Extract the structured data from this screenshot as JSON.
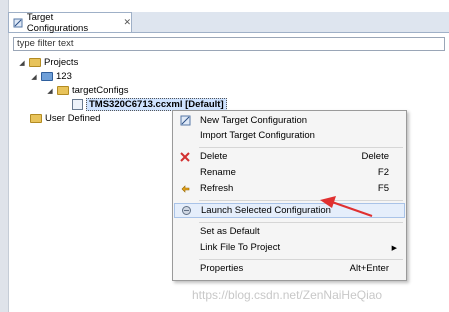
{
  "view": {
    "tab_title": "Target Configurations",
    "filter_placeholder": "type filter text"
  },
  "tree": {
    "projects": "Projects",
    "project_123": "123",
    "target_configs": "targetConfigs",
    "config_file": "TMS320C6713.ccxml [Default]",
    "user_defined": "User Defined"
  },
  "menu": {
    "new_target": "New Target Configuration",
    "import_target": "Import Target Configuration",
    "delete": "Delete",
    "delete_sc": "Delete",
    "rename": "Rename",
    "rename_sc": "F2",
    "refresh": "Refresh",
    "refresh_sc": "F5",
    "launch": "Launch Selected Configuration",
    "set_default": "Set as Default",
    "link_file": "Link File To Project",
    "properties": "Properties",
    "properties_sc": "Alt+Enter"
  },
  "watermark": "https://blog.csdn.net/ZenNaiHeQiao",
  "colors": {
    "accent_arrow": "#e03030",
    "selection": "#cfe3ff"
  }
}
